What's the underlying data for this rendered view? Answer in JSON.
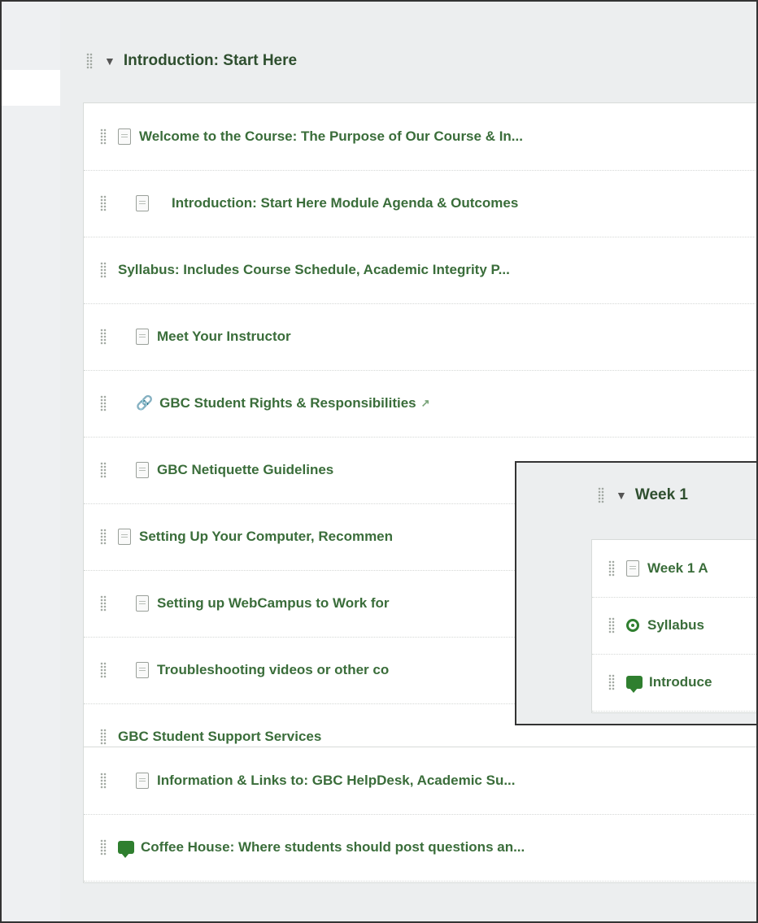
{
  "module": {
    "title": "Introduction: Start Here",
    "items": [
      {
        "label": "Welcome to the Course: The Purpose of Our Course & In...",
        "icon": "page-icon"
      },
      {
        "label": "Introduction: Start Here Module Agenda & Outcomes",
        "icon": "page-icon"
      },
      {
        "label": "Syllabus: Includes Course Schedule, Academic Integrity P...",
        "icon": ""
      },
      {
        "label": "Meet Your Instructor",
        "icon": "page-icon"
      },
      {
        "label": "GBC Student Rights & Responsibilities",
        "icon": "link-icon"
      },
      {
        "label": "GBC Netiquette Guidelines",
        "icon": "page-icon"
      },
      {
        "label": "Setting Up Your Computer, Recommen",
        "icon": "page-icon"
      },
      {
        "label": "Setting up WebCampus to Work for",
        "icon": "page-icon"
      },
      {
        "label": "Troubleshooting videos or other co",
        "icon": "page-icon"
      },
      {
        "label": "GBC Student Support Services",
        "icon": ""
      },
      {
        "label": "Information & Links to: GBC HelpDesk, Academic Su...",
        "icon": "page-icon"
      },
      {
        "label": "Coffee House: Where students should post questions an...",
        "icon": "discussion-icon"
      }
    ]
  },
  "overlay": {
    "title": "Week 1",
    "items": [
      {
        "label": "Week 1 A",
        "icon": "page-icon"
      },
      {
        "label": "Syllabus",
        "icon": "quiz-icon"
      },
      {
        "label": "Introduce",
        "icon": "discussion-icon"
      }
    ]
  },
  "colors": {
    "link_green": "#3a6d3a",
    "discussion_green": "#2f7f2f"
  }
}
